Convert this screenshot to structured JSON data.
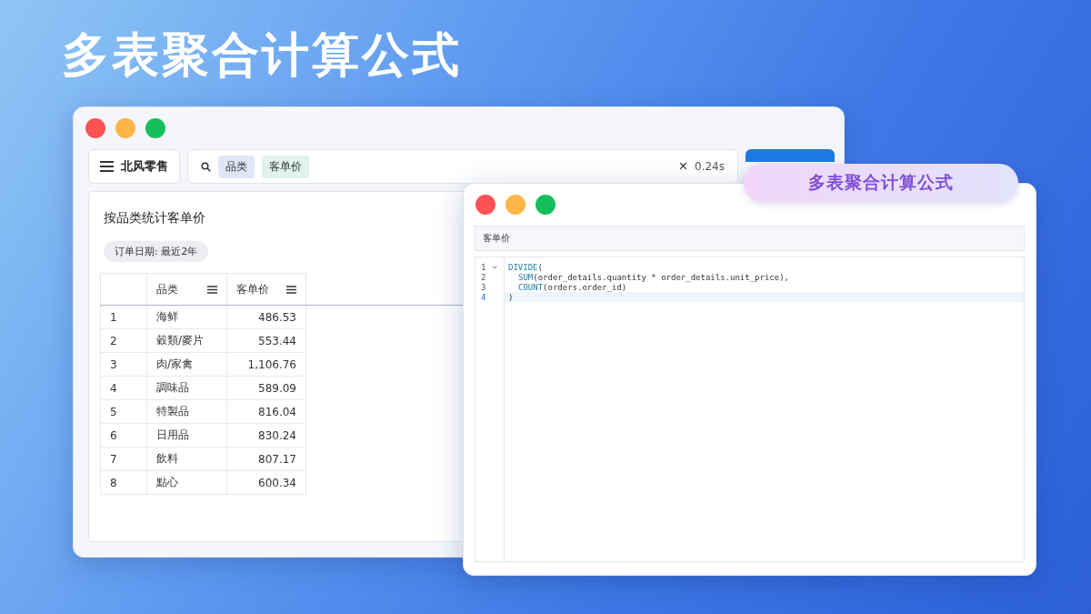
{
  "headline": "多表聚合计算公式",
  "main_window": {
    "toolbar": {
      "menu_label": "北风零售",
      "search_tokens": [
        {
          "label": "品类",
          "color": "#dfe6f7"
        },
        {
          "label": "客单价",
          "color": "#e0f3ea"
        }
      ],
      "clear": "×",
      "elapsed": "0.24s"
    },
    "panel": {
      "title": "按品类统计客单价",
      "filter": "订单日期: 最近2年",
      "table": {
        "columns": [
          "品类",
          "客单价"
        ],
        "rows": [
          {
            "index": "1",
            "category": "海鲜",
            "value": "486.53"
          },
          {
            "index": "2",
            "category": "穀類/麥片",
            "value": "553.44"
          },
          {
            "index": "3",
            "category": "肉/家禽",
            "value": "1,106.76"
          },
          {
            "index": "4",
            "category": "調味品",
            "value": "589.09"
          },
          {
            "index": "5",
            "category": "特製品",
            "value": "816.04"
          },
          {
            "index": "6",
            "category": "日用品",
            "value": "830.24"
          },
          {
            "index": "7",
            "category": "飲料",
            "value": "807.17"
          },
          {
            "index": "8",
            "category": "點心",
            "value": "600.34"
          }
        ]
      }
    }
  },
  "formula_window": {
    "badge": "多表聚合计算公式",
    "field_name": "客单价",
    "code_lines": [
      {
        "number": "1",
        "foldable": true,
        "active": false,
        "indented": false,
        "func": "DIVIDE",
        "rest": "("
      },
      {
        "number": "2",
        "foldable": false,
        "active": false,
        "indented": true,
        "func": "SUM",
        "rest": "(order_details.quantity * order_details.unit_price),"
      },
      {
        "number": "3",
        "foldable": false,
        "active": false,
        "indented": true,
        "func": "COUNT",
        "rest": "(orders.order_id)"
      },
      {
        "number": "4",
        "foldable": false,
        "active": true,
        "indented": false,
        "rest": ")"
      }
    ]
  }
}
